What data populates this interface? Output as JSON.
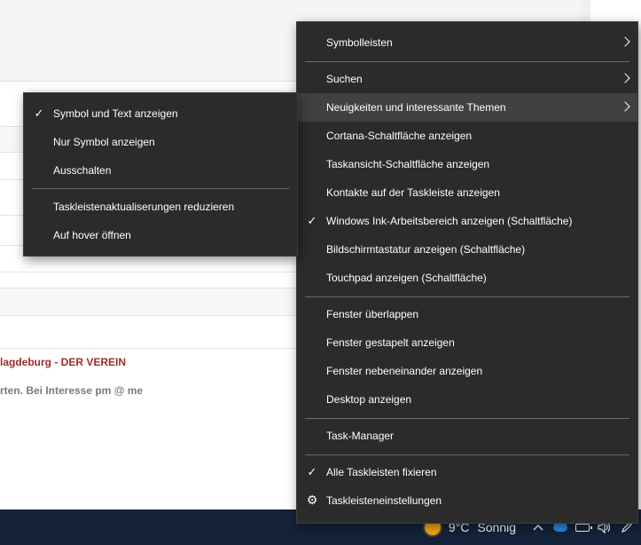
{
  "background": {
    "link_text": "lagdeburg - DER VEREIN",
    "body_text": "rten. Bei Interesse pm @ me"
  },
  "taskbar": {
    "weather_icon": "sun-icon",
    "temperature": "9°C",
    "condition": "Sonnig",
    "tray_icons": [
      "chevron-up-icon",
      "onedrive-cloud-icon",
      "battery-icon",
      "speaker-icon",
      "pen-icon"
    ]
  },
  "main_menu": {
    "items": [
      {
        "label": "Symbolleisten",
        "submenu": true
      },
      {
        "label": "Suchen",
        "submenu": true
      },
      {
        "label": "Neuigkeiten und interessante Themen",
        "submenu": true,
        "highlighted": true
      },
      {
        "label": "Cortana-Schaltfläche anzeigen"
      },
      {
        "label": "Taskansicht-Schaltfläche anzeigen"
      },
      {
        "label": "Kontakte auf der Taskleiste anzeigen"
      },
      {
        "label": "Windows Ink-Arbeitsbereich anzeigen (Schaltfläche)",
        "checked": true
      },
      {
        "label": "Bildschirmtastatur anzeigen (Schaltfläche)"
      },
      {
        "label": "Touchpad anzeigen (Schaltfläche)"
      },
      {
        "label": "Fenster überlappen"
      },
      {
        "label": "Fenster gestapelt anzeigen"
      },
      {
        "label": "Fenster nebeneinander anzeigen"
      },
      {
        "label": "Desktop anzeigen"
      },
      {
        "label": "Task-Manager"
      },
      {
        "label": "Alle Taskleisten fixieren",
        "checked": true
      },
      {
        "label": "Taskleisteneinstellungen",
        "icon": "gear-icon"
      }
    ]
  },
  "sub_menu": {
    "items": [
      {
        "label": "Symbol und Text anzeigen",
        "checked": true
      },
      {
        "label": "Nur Symbol anzeigen"
      },
      {
        "label": "Ausschalten"
      },
      {
        "label": "Taskleistenaktualiserungen reduzieren"
      },
      {
        "label": "Auf hover öffnen"
      }
    ]
  },
  "colors": {
    "menu_bg": "#2b2b2b",
    "menu_highlight": "#414141",
    "taskbar_bg": "#14233a",
    "link_red": "#9b2d2d"
  }
}
